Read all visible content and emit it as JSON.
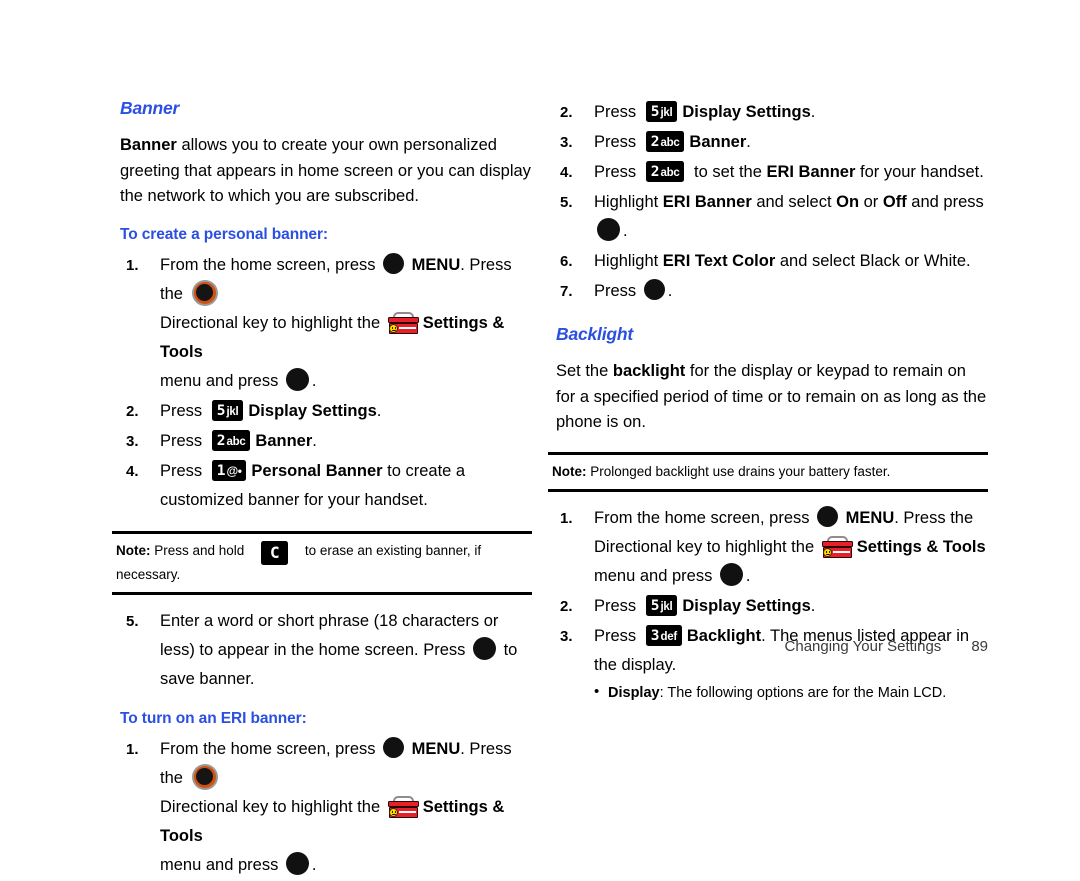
{
  "document": {
    "footer": {
      "section_title": "Changing Your Settings",
      "page_number": "89"
    },
    "accent_heading_color": "#2b4fe0",
    "key_color": "#000000",
    "toolbox_icon_color": "#e8202a"
  },
  "left_column": {
    "section_heading": "Banner",
    "intro": {
      "lead": "Banner",
      "rest": " allows you to create your own personalized greeting that appears in home screen or you can display the network to which you are subscribed."
    },
    "sub_heading_1": "To create a personal banner:",
    "steps_1": [
      {
        "num": "1.",
        "seg_a": "From the home screen, press ",
        "key_ok": "OK",
        "seg_b": " MENU",
        "seg_c": ". Press the ",
        "key_ring": "Directional",
        "seg_d": "Directional key to highlight the ",
        "icon": "Settings & Tools toolbox",
        "seg_e": "Settings & Tools",
        "seg_f": "menu and press ",
        "seg_g": "."
      },
      {
        "num": "2.",
        "seg_a": "Press ",
        "key_digit": "5",
        "key_sub": "jkl",
        "seg_b": "Display Settings",
        "seg_c": "."
      },
      {
        "num": "3.",
        "seg_a": "Press ",
        "key_digit": "2",
        "key_sub": "abc",
        "seg_b": "Banner",
        "seg_c": "."
      },
      {
        "num": "4.",
        "seg_a": "Press ",
        "key_digit": "1",
        "key_sub": "@•",
        "seg_b": "Personal Banner",
        "seg_c": " to create a customized banner for your handset."
      }
    ],
    "note_1": {
      "label": "Note:",
      "text_before": " Press and hold ",
      "key": "C",
      "text_after": " to erase an existing banner, if necessary."
    },
    "steps_2": [
      {
        "num": "5.",
        "seg_a": "Enter a word or short phrase (18 characters or less) to appear in the home screen. Press ",
        "seg_b": " to save banner."
      }
    ],
    "sub_heading_2": "To turn on an ERI banner:",
    "steps_3": [
      {
        "num": "1.",
        "seg_a": "From the home screen, press ",
        "seg_b": " MENU",
        "seg_c": ". Press the ",
        "seg_d": "Directional key to highlight the ",
        "seg_e": "Settings & Tools",
        "seg_f": "menu and press ",
        "seg_g": "."
      }
    ]
  },
  "right_column": {
    "steps_continued": [
      {
        "num": "2.",
        "seg_a": "Press ",
        "key_digit": "5",
        "key_sub": "jkl",
        "seg_b": "Display Settings",
        "seg_c": "."
      },
      {
        "num": "3.",
        "seg_a": "Press ",
        "key_digit": "2",
        "key_sub": "abc",
        "seg_b": "Banner",
        "seg_c": "."
      },
      {
        "num": "4.",
        "seg_a": "Press ",
        "key_digit": "2",
        "key_sub": "abc",
        "seg_b": " to set the ",
        "seg_c": "ERI Banner",
        "seg_d": " for your handset."
      },
      {
        "num": "5.",
        "seg_a": "Highlight ",
        "seg_b": "ERI Banner",
        "seg_c": " and select ",
        "seg_d": "On",
        "seg_e": " or ",
        "seg_f": "Off",
        "seg_g": " and press ",
        "seg_h": "."
      },
      {
        "num": "6.",
        "seg_a": "Highlight ",
        "seg_b": "ERI Text Color",
        "seg_c": " and select Black or White."
      },
      {
        "num": "7.",
        "seg_a": "Press ",
        "seg_b": "."
      }
    ],
    "section_heading": "Backlight",
    "intro": {
      "seg_a": "Set the ",
      "seg_b": "backlight",
      "seg_c": " for the display or keypad to remain on for a specified period of time or to remain on as long as the phone is on."
    },
    "note_1": {
      "label": "Note:",
      "text": " Prolonged backlight use drains your battery faster."
    },
    "steps_backlight": [
      {
        "num": "1.",
        "seg_a": "From the home screen, press ",
        "seg_b": " MENU",
        "seg_c": ". Press the ",
        "seg_d": "Directional key to highlight the ",
        "seg_e": "Settings & Tools",
        "seg_f": "menu and press ",
        "seg_g": "."
      },
      {
        "num": "2.",
        "seg_a": "Press ",
        "key_digit": "5",
        "key_sub": "jkl",
        "seg_b": "Display Settings",
        "seg_c": "."
      },
      {
        "num": "3.",
        "seg_a": "Press ",
        "key_digit": "3",
        "key_sub": "def",
        "seg_b": "Backlight",
        "seg_c": ". The menus listed appear in the display."
      }
    ],
    "bullet": {
      "lead": "Display",
      "rest": ": The following options are for the Main LCD."
    }
  }
}
